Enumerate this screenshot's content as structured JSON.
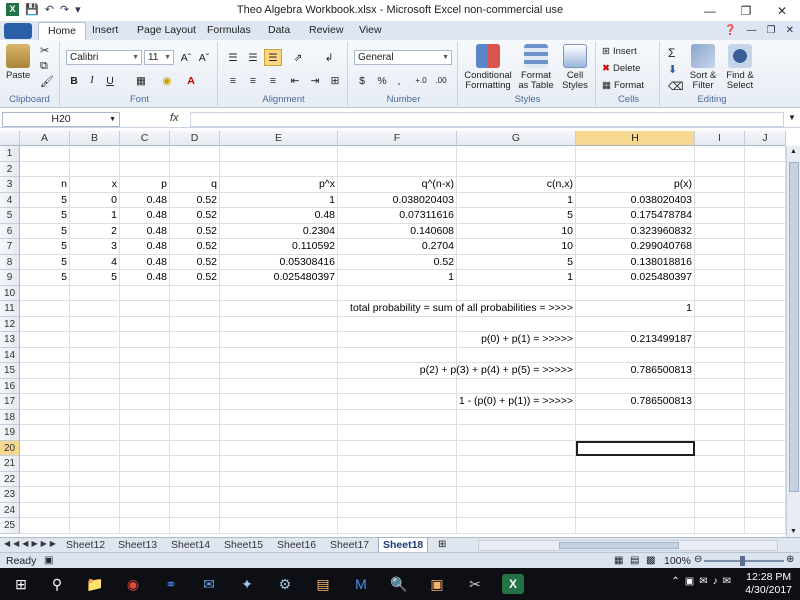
{
  "window": {
    "title": "Theo Algebra Workbook.xlsx - Microsoft Excel non-commercial use",
    "controls": [
      "minimize",
      "restore",
      "close"
    ]
  },
  "ribbon_tabs": [
    "Home",
    "Insert",
    "Page Layout",
    "Formulas",
    "Data",
    "Review",
    "View"
  ],
  "active_tab": "Home",
  "ribbon": {
    "clipboard": {
      "label": "Clipboard",
      "paste": "Paste"
    },
    "font": {
      "label": "Font",
      "name": "Calibri",
      "size": "11",
      "bold": "B",
      "italic": "I",
      "underline": "U"
    },
    "alignment": {
      "label": "Alignment"
    },
    "number": {
      "label": "Number",
      "format": "General",
      "currency": "$",
      "percent": "%",
      "comma": ","
    },
    "styles": {
      "label": "Styles",
      "conditional": "Conditional Formatting",
      "as_table": "Format as Table",
      "cell_styles": "Cell Styles"
    },
    "cells": {
      "label": "Cells",
      "insert": "Insert",
      "delete": "Delete",
      "format": "Format"
    },
    "editing": {
      "label": "Editing",
      "sort": "Sort & Filter",
      "find": "Find & Select"
    }
  },
  "formula_bar": {
    "name_box": "H20",
    "fx": "fx",
    "formula": ""
  },
  "columns": [
    "A",
    "B",
    "C",
    "D",
    "E",
    "F",
    "G",
    "H",
    "I",
    "J"
  ],
  "selected_column": "H",
  "rows": [
    "1",
    "2",
    "3",
    "4",
    "5",
    "6",
    "7",
    "8",
    "9",
    "10",
    "11",
    "12",
    "13",
    "14",
    "15",
    "16",
    "17",
    "18",
    "19",
    "20",
    "21",
    "22",
    "23",
    "24",
    "25"
  ],
  "selected_row": "20",
  "table": {
    "headers": [
      "n",
      "x",
      "p",
      "q",
      "p^x",
      "q^(n-x)",
      "c(n,x)",
      "p(x)"
    ],
    "rows": [
      [
        "5",
        "0",
        "0.48",
        "0.52",
        "1",
        "0.038020403",
        "1",
        "0.038020403"
      ],
      [
        "5",
        "1",
        "0.48",
        "0.52",
        "0.48",
        "0.07311616",
        "5",
        "0.175478784"
      ],
      [
        "5",
        "2",
        "0.48",
        "0.52",
        "0.2304",
        "0.140608",
        "10",
        "0.323960832"
      ],
      [
        "5",
        "3",
        "0.48",
        "0.52",
        "0.110592",
        "0.2704",
        "10",
        "0.299040768"
      ],
      [
        "5",
        "4",
        "0.48",
        "0.52",
        "0.05308416",
        "0.52",
        "5",
        "0.138018816"
      ],
      [
        "5",
        "5",
        "0.48",
        "0.52",
        "0.025480397",
        "1",
        "1",
        "0.025480397"
      ]
    ]
  },
  "summary": {
    "total_label": "total probability = sum of all probabilities = >>>>",
    "total_value": "1",
    "p01_label": "p(0) + p(1) = >>>>>",
    "p01_value": "0.213499187",
    "p2345_label": "p(2) + p(3) + p(4) + p(5) = >>>>>",
    "p2345_value": "0.786500813",
    "complement_label": "1 - (p(0) + p(1)) = >>>>>",
    "complement_value": "0.786500813"
  },
  "sheets": [
    "Sheet12",
    "Sheet13",
    "Sheet14",
    "Sheet15",
    "Sheet16",
    "Sheet17",
    "Sheet18"
  ],
  "active_sheet": "Sheet18",
  "status": {
    "ready": "Ready",
    "zoom": "100%"
  },
  "taskbar": {
    "time": "12:28 PM",
    "date": "4/30/2017"
  }
}
